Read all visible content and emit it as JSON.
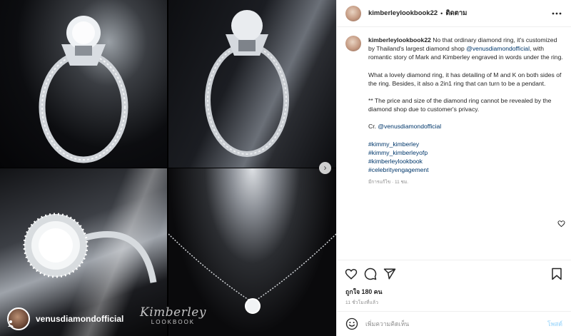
{
  "post": {
    "username": "kimberleylookbook22",
    "follow_label": "ติดตาม",
    "caption": {
      "intro": " No that ordinary diamond ring, it's customized by Thailand's largest diamond shop ",
      "mention": "@venusdiamondofficial",
      "intro_rest": ", with romantic story of Mark and Kimberley engraved in words under the ring.",
      "para2": "What a lovely diamond ring, it has detailing of M and K on both sides of the ring. Besides, it also a 2in1 ring that can turn to be a pendant.",
      "para3": "** The price and size of the diamond ring cannot be revealed by the diamond shop due to customer's privacy.",
      "credit_prefix": "Cr. ",
      "credit_mention": "@venusdiamondofficial",
      "hashtags": [
        "#kimmy_kimberley",
        "#kimmy_kimberleyofp",
        "#kimberleylookbook",
        "#celebrityengagement"
      ],
      "edited": "มีการแก้ไข · 11 ชม."
    },
    "likes": "ถูกใจ 180 คน",
    "time": "11 ชั่วโมงที่แล้ว",
    "comment_placeholder": "เพิ่มความคิดเห็น",
    "post_label": "โพสต์"
  },
  "media": {
    "tagged_user": "venusdiamondofficial",
    "watermark_script": "Kimberley",
    "watermark_text": "LOOKBOOK",
    "next_icon": "chevron-right-icon"
  },
  "icons": {
    "more": "more-horizontal-icon",
    "like": "heart-icon",
    "comment": "comment-icon",
    "share": "paper-plane-icon",
    "save": "bookmark-icon",
    "emoji": "smiley-icon"
  }
}
